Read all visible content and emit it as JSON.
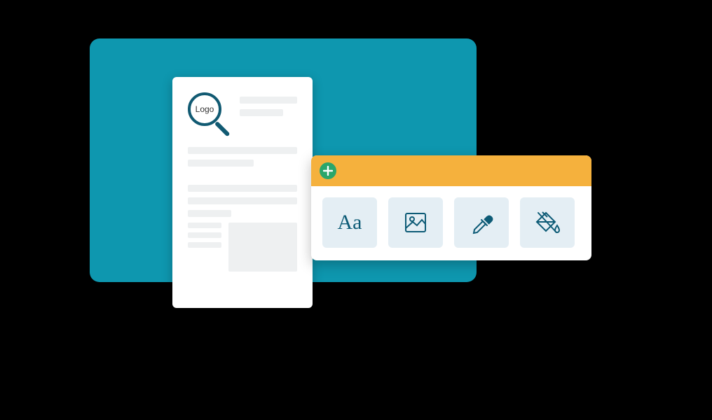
{
  "logo": {
    "label": "Logo"
  },
  "toolbar": {
    "add_icon": "plus-icon",
    "tools": [
      {
        "name": "text-tool",
        "label": "Aa",
        "icon": "text"
      },
      {
        "name": "image-tool",
        "label": "",
        "icon": "image"
      },
      {
        "name": "picker-tool",
        "label": "",
        "icon": "eyedropper"
      },
      {
        "name": "fill-tool",
        "label": "",
        "icon": "paint-bucket"
      }
    ]
  },
  "colors": {
    "stage": "#0e97af",
    "accent": "#f5b13d",
    "add": "#2aa66b",
    "stroke": "#0d5b76"
  }
}
